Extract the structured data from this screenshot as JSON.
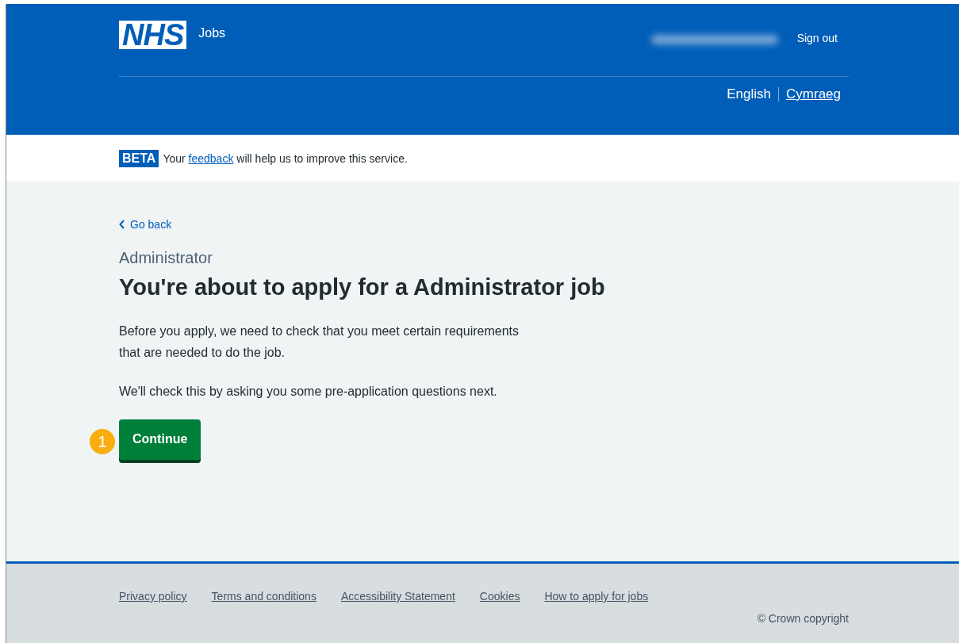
{
  "header": {
    "logo": "NHS",
    "service": "Jobs",
    "sign_out": "Sign out",
    "languages": [
      {
        "label": "English",
        "selected": true
      },
      {
        "label": "Cymraeg",
        "selected": false
      }
    ]
  },
  "phase_banner": {
    "tag": "BETA",
    "before": "Your ",
    "link": "feedback",
    "after": " will help us to improve this service."
  },
  "back_link": "Go back",
  "caption": "Administrator",
  "heading": "You're about to apply for a Administrator job",
  "paragraphs": [
    "Before you apply, we need to check that you meet certain requirements that are needed to do the job.",
    "We'll check this by asking you some pre-application questions next."
  ],
  "step_marker": "1",
  "button": "Continue",
  "footer": {
    "links": [
      "Privacy policy",
      "Terms and conditions",
      "Accessibility Statement",
      "Cookies",
      "How to apply for jobs"
    ],
    "copyright": "© Crown copyright"
  }
}
